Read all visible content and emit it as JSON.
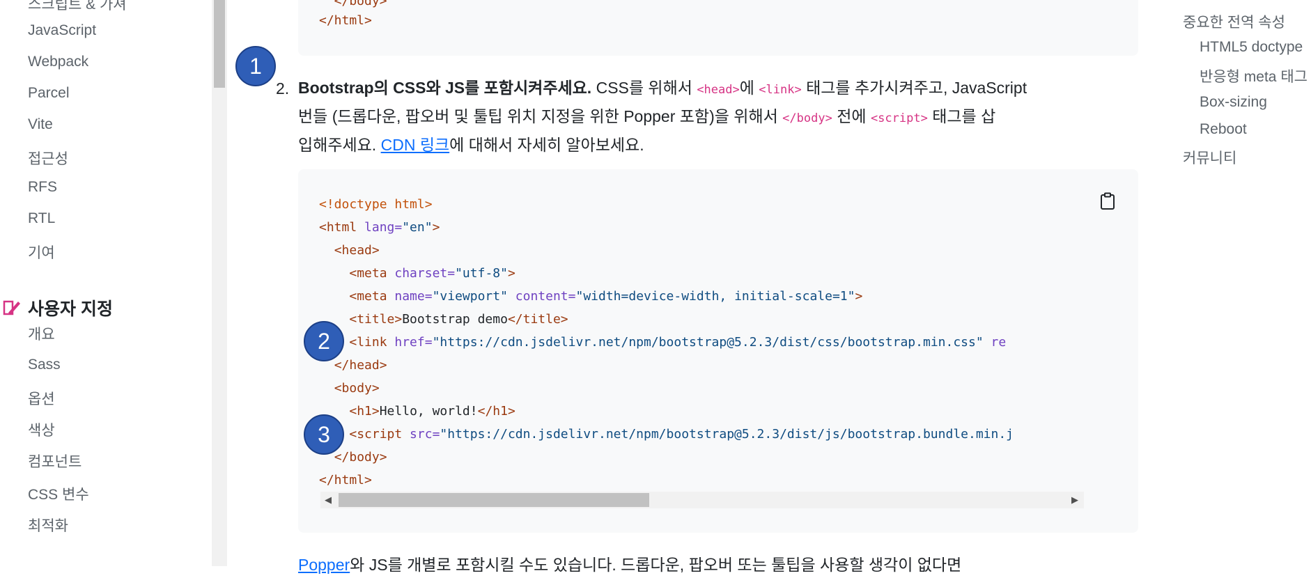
{
  "sidebar": {
    "items_top": [
      "JavaScript",
      "Webpack",
      "Parcel",
      "Vite",
      "접근성",
      "RFS",
      "RTL",
      "기여"
    ],
    "section_title": "사용자 지정",
    "items_bottom": [
      "개요",
      "Sass",
      "옵션",
      "색상",
      "컴포넌트",
      "CSS 변수",
      "최적화"
    ]
  },
  "top_code_tail": {
    "close_html": "</html>"
  },
  "step2": {
    "number": "2.",
    "bold": "Bootstrap의 CSS와 JS를 포함시켜주세요.",
    "t1": " CSS를 위해서 ",
    "c1": "<head>",
    "t2": "에 ",
    "c2": "<link>",
    "t3": " 태그를 추가시켜주고, JavaScript",
    "t4": "번들 (드롭다운, 팝오버 및 툴팁 위치 지정을 위한 Popper 포함)을 위해서 ",
    "c3": "</body>",
    "t5": " 전에 ",
    "c4": "<script>",
    "t6": " 태그를 삽",
    "t7": "입해주세요. ",
    "link": "CDN 링크",
    "t8": "에 대해서 자세히 알아보세요."
  },
  "code": {
    "doctype": "<!doctype html>",
    "html_open_tag": "<html",
    "html_lang_attr": " lang=",
    "html_lang_val": "\"en\"",
    "gt": ">",
    "head_open": "<head>",
    "meta": "<meta",
    "charset_attr": " charset=",
    "charset_val": "\"utf-8\"",
    "name_attr": " name=",
    "name_val": "\"viewport\"",
    "content_attr": " content=",
    "content_val": "\"width=device-width, initial-scale=1\"",
    "title_open": "<title>",
    "title_text": "Bootstrap demo",
    "title_close": "</title>",
    "link_open": "<link",
    "href_attr": " href=",
    "href_val": "\"https://cdn.jsdelivr.net/npm/bootstrap@5.2.3/dist/css/bootstrap.min.css\"",
    "link_rest": " re",
    "head_close": "</head>",
    "body_open": "<body>",
    "h1_open": "<h1>",
    "h1_text": "Hello, world!",
    "h1_close": "</h1>",
    "script_open": "<script",
    "src_attr": " src=",
    "src_val": "\"https://cdn.jsdelivr.net/npm/bootstrap@5.2.3/dist/js/bootstrap.bundle.min.j",
    "body_close": "</body>",
    "html_close": "</html>"
  },
  "markers": [
    "1",
    "2",
    "3"
  ],
  "bottom_para": {
    "link": "Popper",
    "text": "와 JS를 개별로 포함시킬 수도 있습니다. 드롭다운, 팝오버 또는 툴팁을 사용할 생각이 없다면"
  },
  "toc": {
    "items": [
      "중요한 전역 속성",
      "HTML5 doctype",
      "반응형 meta 태그",
      "Box-sizing",
      "Reboot",
      "커뮤니티"
    ]
  },
  "colors": {
    "marker": "#2f5eb7",
    "accent_icon": "#d63384",
    "link": "#0d6efd"
  }
}
